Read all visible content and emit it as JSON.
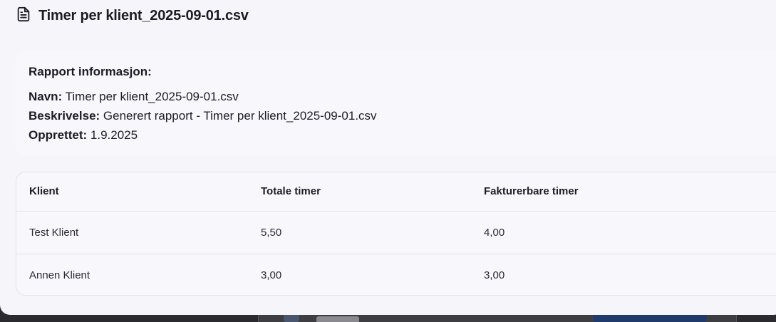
{
  "dialog": {
    "title": "Timer per klient_2025-09-01.csv",
    "icon": "document-icon"
  },
  "info": {
    "heading": "Rapport informasjon:",
    "name_label": "Navn:",
    "name_value": "Timer per klient_2025-09-01.csv",
    "description_label": "Beskrivelse:",
    "description_value": "Generert rapport - Timer per klient_2025-09-01.csv",
    "created_label": "Opprettet:",
    "created_value": "1.9.2025"
  },
  "table": {
    "headers": [
      "Klient",
      "Totale timer",
      "Fakturerbare timer"
    ],
    "rows": [
      [
        "Test Klient",
        "5,50",
        "4,00"
      ],
      [
        "Annen Klient",
        "3,00",
        "3,00"
      ]
    ]
  },
  "colors": {
    "dialog_bg": "#f6f6fa",
    "card_bg": "#f8f8fc",
    "border": "#e2e2ea",
    "text": "#1c1c24"
  }
}
